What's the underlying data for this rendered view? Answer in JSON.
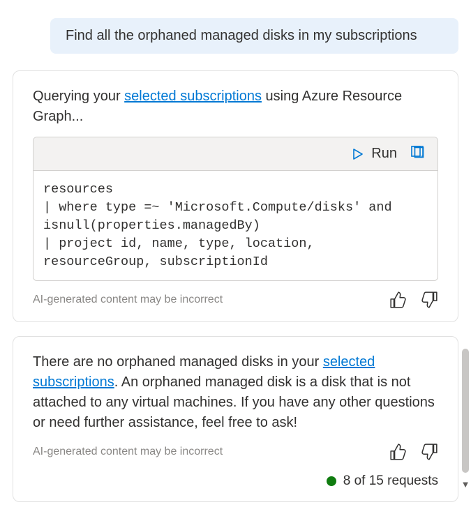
{
  "user_message": "Find all the orphaned managed disks in my subscriptions",
  "card1": {
    "prefix": "Querying your ",
    "link": "selected subscriptions",
    "suffix": " using Azure Resource Graph...",
    "run_label": "Run",
    "code": "resources\n| where type =~ 'Microsoft.Compute/disks' and isnull(properties.managedBy)\n| project id, name, type, location, resourceGroup, subscriptionId",
    "disclaimer": "AI-generated content may be incorrect"
  },
  "card2": {
    "prefix": "There are no orphaned managed disks in your ",
    "link": "selected subscriptions",
    "suffix": ". An orphaned managed disk is a disk that is not attached to any virtual machines. If you have any other questions or need further assistance, feel free to ask!",
    "disclaimer": "AI-generated content may be incorrect",
    "requests": "8 of 15 requests"
  },
  "colors": {
    "link": "#0078d4",
    "status_dot": "#107c10"
  }
}
